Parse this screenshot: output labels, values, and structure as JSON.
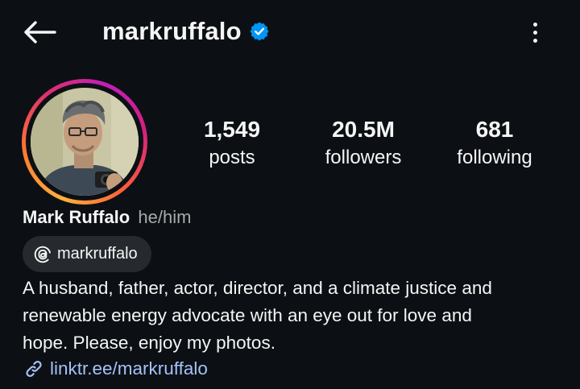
{
  "header": {
    "back_icon": "arrow-left-icon",
    "username": "markruffalo",
    "verified_icon": "verified-badge-icon",
    "more_icon": "more-vertical-icon"
  },
  "profile": {
    "avatar": "profile-photo",
    "stats": [
      {
        "value": "1,549",
        "label": "posts"
      },
      {
        "value": "20.5M",
        "label": "followers"
      },
      {
        "value": "681",
        "label": "following"
      }
    ],
    "name": "Mark Ruffalo",
    "pronouns": "he/him",
    "threads": {
      "icon": "threads-icon",
      "label": "markruffalo"
    },
    "bio_lines": [
      "A husband, father, actor, director, and a climate justice and",
      "renewable energy advocate with an eye out for love and",
      "hope. Please, enjoy my photos."
    ],
    "link": {
      "icon": "link-icon",
      "label": "linktr.ee/markruffalo"
    }
  },
  "colors": {
    "background": "#0c1014",
    "text": "#f5f5f5",
    "muted": "#a8a8a8",
    "verified": "#0095f6",
    "link": "#a4c2f8",
    "chip": "#262a2e"
  }
}
